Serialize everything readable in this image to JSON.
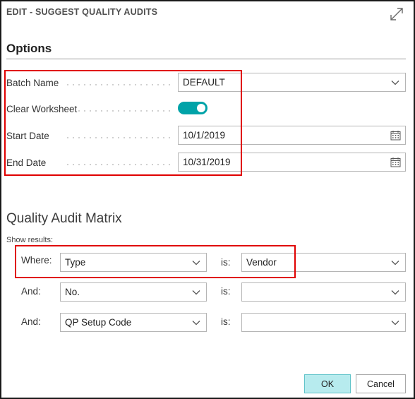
{
  "dialog": {
    "title": "EDIT - SUGGEST QUALITY AUDITS",
    "expand_icon": "expand-diagonal-icon"
  },
  "options": {
    "section_title": "Options",
    "batch_name": {
      "label": "Batch Name",
      "value": "DEFAULT"
    },
    "clear_worksheet": {
      "label": "Clear Worksheet",
      "enabled": true
    },
    "start_date": {
      "label": "Start Date",
      "value": "10/1/2019"
    },
    "end_date": {
      "label": "End Date",
      "value": "10/31/2019"
    }
  },
  "matrix": {
    "title": "Quality Audit Matrix",
    "show_results": "Show results:",
    "rows": [
      {
        "label": "Where:",
        "field": "Type",
        "is_label": "is:",
        "value": "Vendor"
      },
      {
        "label": "And:",
        "field": "No.",
        "is_label": "is:",
        "value": ""
      },
      {
        "label": "And:",
        "field": "QP Setup Code",
        "is_label": "is:",
        "value": ""
      }
    ]
  },
  "buttons": {
    "ok": "OK",
    "cancel": "Cancel"
  },
  "colors": {
    "accent": "#00a3a8",
    "ok_button": "#b7ebee",
    "highlight": "#e00000"
  }
}
